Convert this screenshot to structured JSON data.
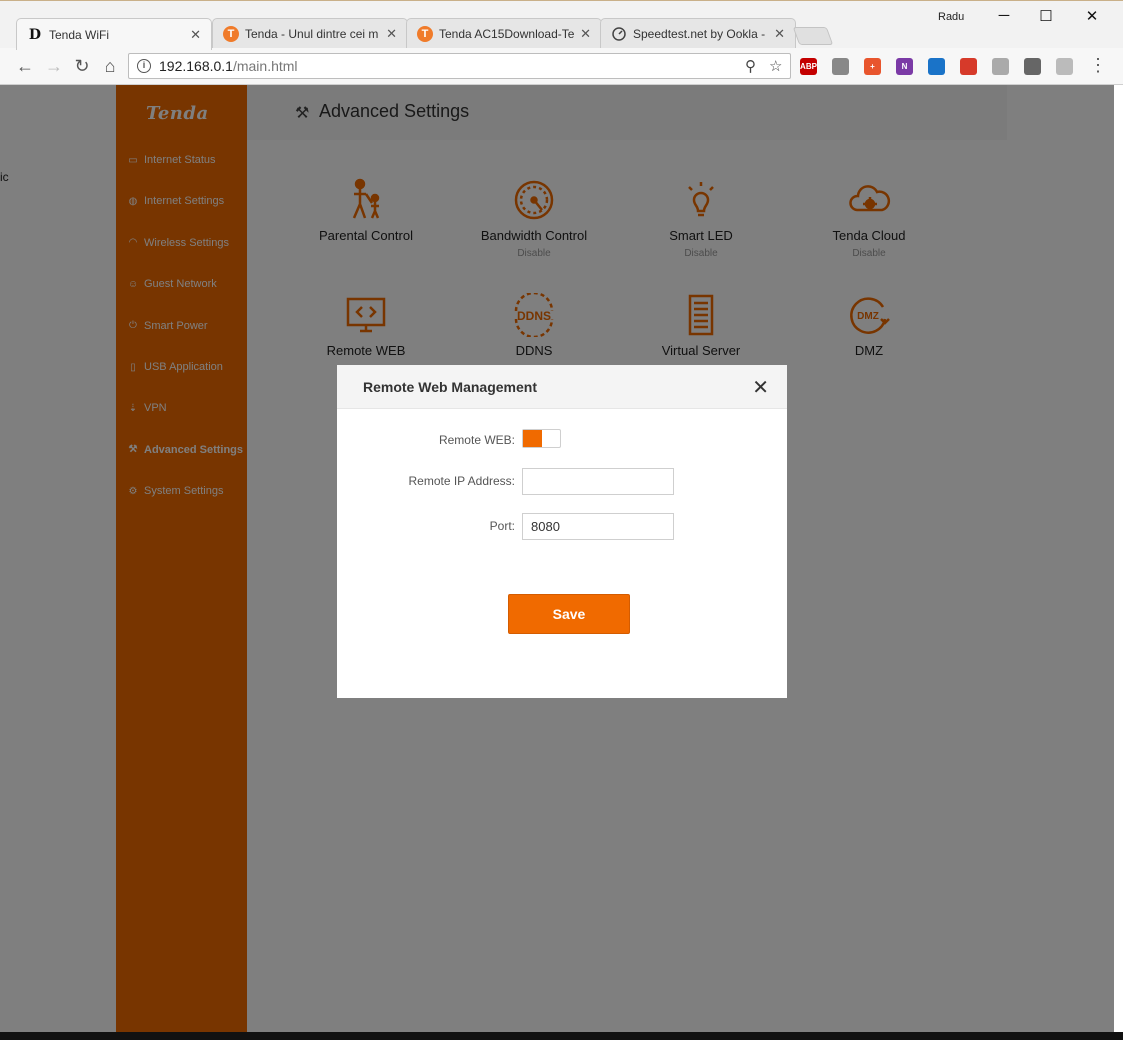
{
  "browser": {
    "tabs": [
      {
        "label": "Tenda WiFi",
        "favicon": "D",
        "active": true
      },
      {
        "label": "Tenda - Unul dintre cei m",
        "favicon": "T",
        "active": false
      },
      {
        "label": "Tenda AC15Download-Te",
        "favicon": "T",
        "active": false
      },
      {
        "label": "Speedtest.net by Ookla -",
        "favicon": "speedometer-icon",
        "active": false
      }
    ],
    "user": "Radu",
    "url_host": "192.168.0.1",
    "url_path": "/main.html",
    "extensions": [
      {
        "name": "adblock-icon",
        "label": "ABP",
        "color": "#c40000"
      },
      {
        "name": "camera-icon",
        "label": "",
        "color": "#888888"
      },
      {
        "name": "plus-extension-icon",
        "label": "+",
        "color": "#e8552d"
      },
      {
        "name": "onenote-icon",
        "label": "N",
        "color": "#7b3aa6"
      },
      {
        "name": "globe-extension-icon",
        "label": "",
        "color": "#1a73c8"
      },
      {
        "name": "rocket-extension-icon",
        "label": "",
        "color": "#d63a2a"
      },
      {
        "name": "history-icon",
        "label": "",
        "color": "#aaaaaa"
      },
      {
        "name": "pin-icon",
        "label": "",
        "color": "#666666"
      },
      {
        "name": "grid-extension-icon",
        "label": "",
        "color": "#bbbbbb"
      }
    ]
  },
  "router": {
    "logo": "Tenda",
    "accent": "#f06a00",
    "sidebar": [
      {
        "label": "Internet Status",
        "icon": "monitor-icon"
      },
      {
        "label": "Internet Settings",
        "icon": "globe-icon"
      },
      {
        "label": "Wireless Settings",
        "icon": "wifi-icon"
      },
      {
        "label": "Guest Network",
        "icon": "guest-icon"
      },
      {
        "label": "Smart Power",
        "icon": "power-icon"
      },
      {
        "label": "USB Application",
        "icon": "usb-icon"
      },
      {
        "label": "VPN",
        "icon": "vpn-icon"
      },
      {
        "label": "Advanced Settings",
        "icon": "wrench-icon",
        "active": true
      },
      {
        "label": "System Settings",
        "icon": "settings-icon"
      }
    ],
    "page_title": "Advanced Settings",
    "tiles": [
      {
        "name": "Parental Control",
        "status": ""
      },
      {
        "name": "Bandwidth Control",
        "status": "Disable"
      },
      {
        "name": "Smart LED",
        "status": "Disable"
      },
      {
        "name": "Tenda Cloud",
        "status": "Disable"
      },
      {
        "name": "Remote WEB",
        "status": ""
      },
      {
        "name": "DDNS",
        "status": ""
      },
      {
        "name": "Virtual Server",
        "status": ""
      },
      {
        "name": "DMZ",
        "status": ""
      }
    ]
  },
  "modal": {
    "title": "Remote Web Management",
    "fields": {
      "remote_web_label": "Remote WEB:",
      "remote_web_enabled": true,
      "remote_ip_label": "Remote IP Address:",
      "remote_ip_value": "",
      "port_label": "Port:",
      "port_value": "8080"
    },
    "save_label": "Save"
  }
}
